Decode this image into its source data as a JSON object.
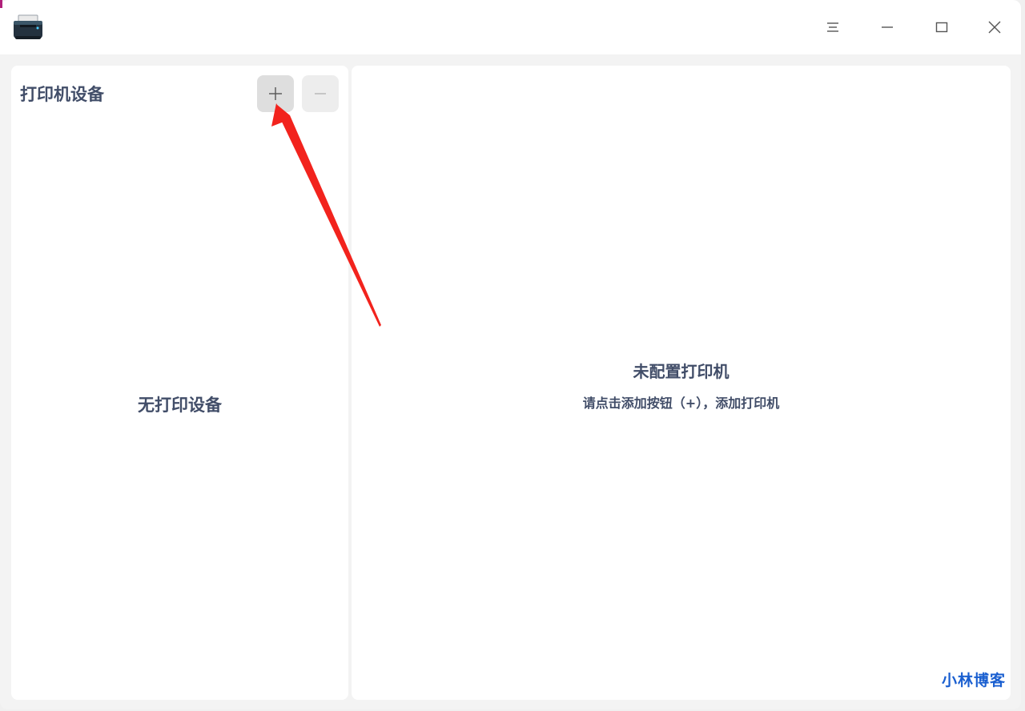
{
  "app": {
    "icon": "printer-icon"
  },
  "titlebar": {
    "menu_icon": "hamburger-menu-icon",
    "minimize_icon": "minimize-icon",
    "maximize_icon": "maximize-icon",
    "close_icon": "close-icon"
  },
  "left_panel": {
    "title": "打印机设备",
    "add_button_label": "+",
    "remove_button_label": "−",
    "empty_text": "无打印设备"
  },
  "right_panel": {
    "title": "未配置打印机",
    "hint": "请点击添加按钮（+），添加打印机"
  },
  "annotation": {
    "arrow_color": "#f2231d"
  },
  "watermark": {
    "text": "小林博客",
    "color": "#1a5fd0"
  },
  "colors": {
    "text": "#414d68",
    "panel_bg": "#ffffff",
    "window_bg": "#f3f3f3"
  }
}
